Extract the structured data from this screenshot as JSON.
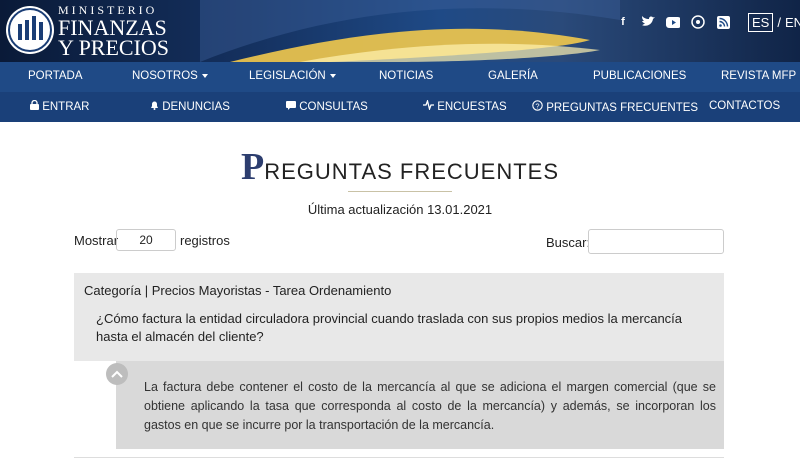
{
  "header": {
    "logo_line1": "MINISTERIO",
    "logo_line2": "FINANZAS",
    "logo_line3": "Y PRECIOS",
    "social_icons": [
      "facebook-icon",
      "twitter-icon",
      "youtube-icon",
      "podcast-icon",
      "rss-icon"
    ],
    "lang_es": "ES",
    "lang_sep": "/",
    "lang_en": "EN"
  },
  "nav_primary": [
    {
      "label": "PORTADA",
      "dropdown": false
    },
    {
      "label": "NOSOTROS",
      "dropdown": true
    },
    {
      "label": "LEGISLACIÓN",
      "dropdown": true
    },
    {
      "label": "NOTICIAS",
      "dropdown": false
    },
    {
      "label": "GALERÍA",
      "dropdown": false
    },
    {
      "label": "PUBLICACIONES",
      "dropdown": false
    },
    {
      "label": "REVISTA MFP",
      "dropdown": false
    }
  ],
  "nav_secondary": [
    {
      "label": "ENTRAR",
      "icon": "lock-icon"
    },
    {
      "label": "DENUNCIAS",
      "icon": "bell-icon"
    },
    {
      "label": "CONSULTAS",
      "icon": "chat-icon"
    },
    {
      "label": "ENCUESTAS",
      "icon": "pulse-icon"
    },
    {
      "label": "PREGUNTAS FRECUENTES",
      "icon": "question-circle-icon"
    },
    {
      "label": "CONTACTOS",
      "icon": ""
    }
  ],
  "page": {
    "title_initial": "P",
    "title_rest": "REGUNTAS FRECUENTES",
    "updated": "Última actualización 13.01.2021"
  },
  "table": {
    "show_label": "Mostrar",
    "show_value": "20",
    "records_label": "registros",
    "search_label": "Buscar:"
  },
  "faq": {
    "category": "Categoría | Precios Mayoristas - Tarea Ordenamiento",
    "question": "¿Cómo factura la entidad circuladora provincial cuando traslada con sus propios medios la mercancía hasta el almacén del cliente?",
    "answer": "La factura debe contener el costo de la mercancía al que se adiciona el margen comercial (que se obtiene aplicando la tasa que corresponda al costo de la mercancía) y además, se incorporan los gastos en que se incurre por la transportación de la mercancía."
  }
}
